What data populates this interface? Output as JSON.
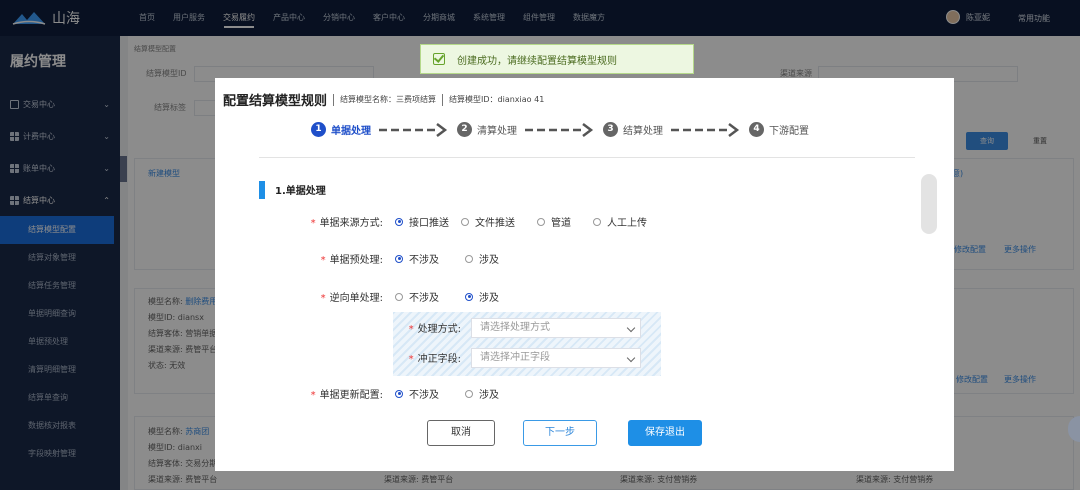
{
  "app": {
    "logo_text": "山海"
  },
  "topnav": [
    {
      "label": "首页"
    },
    {
      "label": "用户服务"
    },
    {
      "label": "交易履约",
      "active": true
    },
    {
      "label": "产品中心"
    },
    {
      "label": "分销中心"
    },
    {
      "label": "客户中心"
    },
    {
      "label": "分期商城"
    },
    {
      "label": "系统管理"
    },
    {
      "label": "组件管理"
    },
    {
      "label": "数据魔方"
    }
  ],
  "user": {
    "name": "陈亚妮",
    "common_functions": "常用功能"
  },
  "sidebar": {
    "title": "履约管理",
    "groups": [
      {
        "label": "交易中心"
      },
      {
        "label": "计费中心"
      },
      {
        "label": "账单中心"
      },
      {
        "label": "结算中心"
      }
    ],
    "items": [
      {
        "label": "结算模型配置"
      },
      {
        "label": "结算对象管理"
      },
      {
        "label": "结算任务管理"
      },
      {
        "label": "单据明细查询"
      },
      {
        "label": "单据预处理"
      },
      {
        "label": "清算明细管理"
      },
      {
        "label": "结算单查询"
      },
      {
        "label": "数据核对报表"
      },
      {
        "label": "字段映射管理"
      }
    ]
  },
  "background": {
    "breadcrumb": "结算模型配置",
    "search_model_id": "结算模型ID",
    "search_tag": "结算标签",
    "search_channel": "渠道来源",
    "query_button": "查询",
    "reset_button": "重置",
    "new_model": "新建模型",
    "card_fields": {
      "model_name": "模型名称:",
      "model_id": "模型ID:",
      "settle_desc": "结算客体:",
      "channel": "渠道来源:",
      "status": "状态:"
    },
    "card1": {
      "name": "删除费用",
      "id": "diansx",
      "desc": "营销单据",
      "channel": "费管平台",
      "status": "无效"
    },
    "card2": {
      "name": "苏商团",
      "id": "dianxi",
      "desc": "交易分期",
      "channel": "费管平台"
    },
    "bottom_channels": [
      "渠道来源: 费管平台",
      "渠道来源: 支付营销券",
      "渠道来源: 支付营销券"
    ],
    "edit_config": "修改配置",
    "more_ops": "更多操作",
    "partial_tag": "意)"
  },
  "toast": {
    "message": "创建成功，请继续配置结算模型规则"
  },
  "modal": {
    "title": "配置结算模型规则",
    "model_name": "结算模型名称：三费项结算",
    "model_id": "结算模型ID：dianxiao 41",
    "steps": [
      {
        "num": "1",
        "label": "单据处理"
      },
      {
        "num": "2",
        "label": "清算处理"
      },
      {
        "num": "3",
        "label": "结算处理"
      },
      {
        "num": "4",
        "label": "下游配置"
      }
    ],
    "section_title": "1.单据处理",
    "fields": {
      "source": {
        "label": "单据来源方式:",
        "options": [
          "接口推送",
          "文件推送",
          "管道",
          "人工上传"
        ]
      },
      "preprocess": {
        "label": "单据预处理:",
        "options": [
          "不涉及",
          "涉及"
        ]
      },
      "reverse": {
        "label": "逆向单处理:",
        "options": [
          "不涉及",
          "涉及"
        ]
      },
      "handling": {
        "label": "处理方式:",
        "placeholder": "请选择处理方式"
      },
      "offset": {
        "label": "冲正字段:",
        "placeholder": "请选择冲正字段"
      },
      "update": {
        "label": "单据更新配置:",
        "options": [
          "不涉及",
          "涉及"
        ]
      }
    },
    "buttons": {
      "cancel": "取消",
      "next": "下一步",
      "save_exit": "保存退出"
    }
  }
}
